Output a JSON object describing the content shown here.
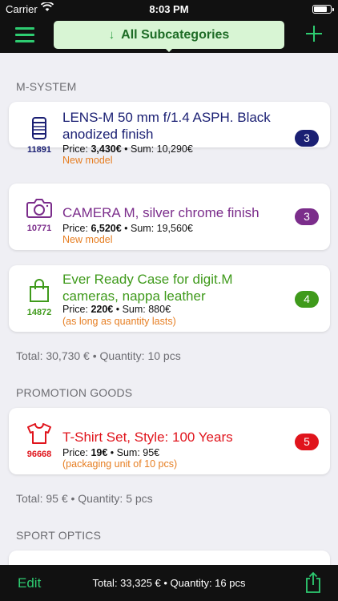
{
  "status_bar": {
    "carrier": "Carrier",
    "time": "8:03 PM",
    "battery_level": 0.8
  },
  "navbar": {
    "menu_icon": "hamburger-icon",
    "subcategory_arrow": "↓",
    "subcategory_label": "All Subcategories",
    "add_icon": "plus-icon"
  },
  "sections": [
    {
      "header": "M-SYSTEM",
      "items": [
        {
          "icon": "lens-icon",
          "code": "11891",
          "title": "LENS-M 50 mm f/1.4 ASPH. Black anodized finish",
          "price_label": "Price:",
          "price": "3,430€",
          "sum": "• Sum: 10,290€",
          "note": "New model",
          "badge": "3",
          "color": "#1a1f73"
        },
        {
          "icon": "camera-icon",
          "code": "10771",
          "title": "CAMERA M, silver chrome finish",
          "price_label": "Price:",
          "price": "6,520€",
          "sum": "• Sum: 19,560€",
          "note": "New model",
          "badge": "3",
          "color": "#7b2d8b"
        },
        {
          "icon": "shopping-bag-icon",
          "code": "14872",
          "title": "Ever Ready Case for digit.M cameras, nappa leather",
          "price_label": "Price:",
          "price": "220€",
          "sum": "• Sum: 880€",
          "note": "(as long as quantity lasts)",
          "badge": "4",
          "color": "#3f9a1b"
        }
      ],
      "total": "Total: 30,730 € • Quantity: 10 pcs"
    },
    {
      "header": "PROMOTION GOODS",
      "items": [
        {
          "icon": "tshirt-icon",
          "code": "96668",
          "title": "T-Shirt Set, Style: 100 Years",
          "price_label": "Price:",
          "price": "19€",
          "sum": "• Sum: 95€",
          "note": "(packaging unit of 10 pcs)",
          "badge": "5",
          "color": "#e0141c"
        }
      ],
      "total": "Total: 95 € • Quantity: 5 pcs"
    },
    {
      "header": "SPORT OPTICS",
      "items": [],
      "total": ""
    }
  ],
  "bottom_bar": {
    "edit_label": "Edit",
    "summary": "Total: 33,325 € • Quantity: 16 pcs",
    "share_icon": "share-icon"
  },
  "colors": {
    "accent": "#2ecc71",
    "note": "#e67e22",
    "bar_bg": "#111111"
  }
}
